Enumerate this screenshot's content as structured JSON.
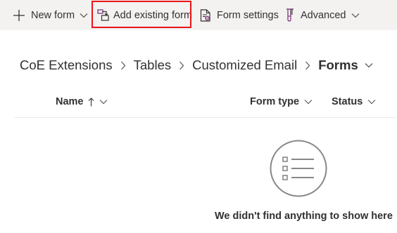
{
  "toolbar": {
    "new_form": {
      "label": "New form",
      "icon": "plus-icon",
      "chevron": "chevron-down-icon"
    },
    "add_existing_form": {
      "label": "Add existing form",
      "icon": "add-existing-icon",
      "highlight_color": "#e8151b"
    },
    "form_settings": {
      "label": "Form settings",
      "icon": "form-settings-icon"
    },
    "advanced": {
      "label": "Advanced",
      "icon": "flask-icon",
      "chevron": "chevron-down-icon"
    },
    "background": "#f3f2f1"
  },
  "breadcrumb": {
    "items": [
      "CoE Extensions",
      "Tables",
      "Customized Email"
    ],
    "current": "Forms"
  },
  "columns": {
    "name": {
      "label": "Name",
      "sort": "ascending"
    },
    "form_type": {
      "label": "Form type"
    },
    "status": {
      "label": "Status"
    }
  },
  "empty_state": {
    "icon": "empty-list-icon",
    "message": "We didn't find anything to show here"
  },
  "colors": {
    "accent_icon": "#742774",
    "text": "#323130",
    "divider": "#edebe9"
  }
}
